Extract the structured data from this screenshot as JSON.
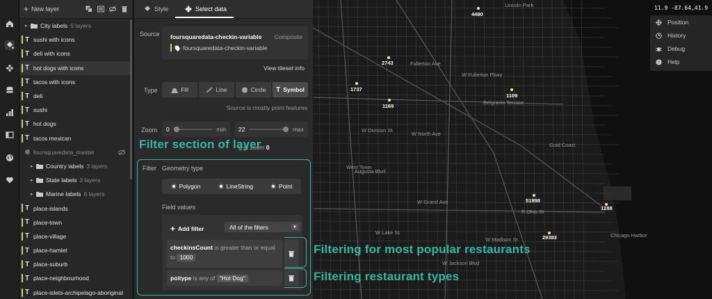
{
  "layers_toolbar": {
    "new_layer": "New layer"
  },
  "layers": [
    {
      "label": "City labels",
      "count": "5 layers",
      "kind": "group"
    },
    {
      "label": "sushi with icons",
      "kind": "symbol"
    },
    {
      "label": "deli with icons",
      "kind": "symbol"
    },
    {
      "label": "hot dogs with icons",
      "kind": "symbol",
      "selected": true
    },
    {
      "label": "tacos with icons",
      "kind": "symbol"
    },
    {
      "label": "deli",
      "kind": "symbol"
    },
    {
      "label": "sushi",
      "kind": "symbol"
    },
    {
      "label": "hot dogs",
      "kind": "symbol"
    },
    {
      "label": "tacos mexican",
      "kind": "symbol"
    },
    {
      "label": "foursquaredata_master",
      "kind": "hidden"
    },
    {
      "label": "Country labels",
      "count": "3 layers",
      "kind": "group"
    },
    {
      "label": "State labels",
      "count": "3 layers",
      "kind": "group"
    },
    {
      "label": "Marine labels",
      "count": "6 layers",
      "kind": "group"
    },
    {
      "label": "place-islands",
      "kind": "symbol"
    },
    {
      "label": "place-town",
      "kind": "symbol"
    },
    {
      "label": "place-village",
      "kind": "symbol"
    },
    {
      "label": "place-hamlet",
      "kind": "symbol"
    },
    {
      "label": "place-suburb",
      "kind": "symbol"
    },
    {
      "label": "place-neighbourhood",
      "kind": "symbol"
    },
    {
      "label": "place-islets-archipelago-aboriginal",
      "kind": "symbol"
    }
  ],
  "tabs": {
    "style": "Style",
    "select_data": "Select data"
  },
  "source": {
    "label": "Source",
    "name": "foursquaredata-checkin-variable",
    "type": "Composite",
    "sublayer": "foursquaredata-checkin-variable",
    "view_info": "View tileset info"
  },
  "type": {
    "label": "Type",
    "options": [
      "Fill",
      "Line",
      "Circle",
      "Symbol"
    ],
    "active": "Symbol",
    "note": "Source is mostly point features"
  },
  "zoom": {
    "label": "Zoom",
    "min_value": "0",
    "min_unit": "min",
    "max_value": "22",
    "max_unit": "max"
  },
  "hint": {
    "prefix": "g at zoom",
    "value": "0"
  },
  "filter": {
    "label": "Filter",
    "geometry_label": "Geometry type",
    "geometry_options": [
      "Polygon",
      "LineString",
      "Point"
    ],
    "field_values_label": "Field values",
    "add_filter": "Add filter",
    "match_mode": "All of the filters",
    "conditions": [
      {
        "field": "checkinsCount",
        "op": "is greater than or equal to",
        "value": "1000"
      },
      {
        "field": "poitype",
        "op": "is any of",
        "value": "\"Hot Dog\""
      }
    ]
  },
  "annotations": {
    "filter_section": "Filter section of layer",
    "popular": "Filtering for most popular restaurants",
    "types": "Filtering restaurant types"
  },
  "map": {
    "labels": [
      "Lincoln Park",
      "Fullerton Ave",
      "W Fullerton Pkwy",
      "Belgravia Terrace",
      "Gold Coast",
      "West Town",
      "Chicago Harbor",
      "W Lake St",
      "W Jackson Blvd",
      "Augusta Blvd",
      "W Grand Ave",
      "W Division St",
      "W North Ave",
      "E Ohio St",
      "W Madison St"
    ],
    "counts": [
      "4480",
      "2743",
      "1737",
      "1169",
      "1109",
      "51898",
      "1288",
      "29383"
    ]
  },
  "tools": {
    "coords": "11.9 -87.64,41.9",
    "items": [
      "Position",
      "History",
      "Debug",
      "Help"
    ]
  },
  "colors": {
    "accent_teal": "#3bb8a6",
    "layer_marker": "#c9dc6a",
    "poi": "#ffe89a"
  }
}
